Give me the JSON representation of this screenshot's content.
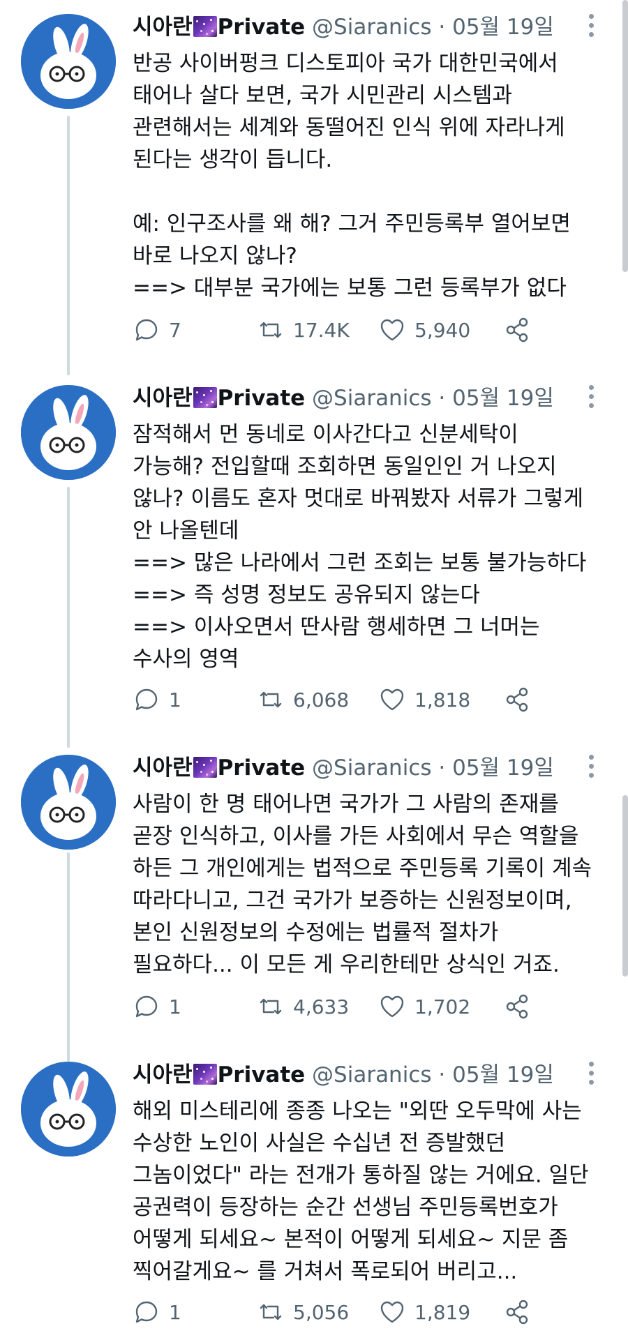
{
  "tweets": [
    {
      "name": "시아란",
      "badge": "Private",
      "handle": "@Siaranics",
      "dot": "·",
      "date": "05월 19일",
      "lines": [
        "반공 사이버펑크 디스토피아 국가 대한민국에서",
        "태어나 살다 보면, 국가 시민관리 시스템과",
        "관련해서는 세계와 동떨어진 인식 위에 자라나게",
        "된다는 생각이 듭니다.",
        "",
        "예: 인구조사를 왜 해? 그거 주민등록부 열어보면",
        "바로 나오지 않나?",
        "==> 대부분 국가에는 보통 그런 등록부가 없다"
      ],
      "replies": "7",
      "retweets": "17.4K",
      "likes": "5,940"
    },
    {
      "name": "시아란",
      "badge": "Private",
      "handle": "@Siaranics",
      "dot": "·",
      "date": "05월 19일",
      "lines": [
        "잠적해서 먼 동네로 이사간다고 신분세탁이",
        "가능해? 전입할때 조회하면 동일인인 거 나오지",
        "않나? 이름도 혼자 멋대로 바꿔봤자 서류가 그렇게",
        "안 나올텐데",
        "==> 많은 나라에서 그런 조회는 보통 불가능하다",
        "==> 즉 성명 정보도 공유되지 않는다",
        "==> 이사오면서 딴사람 행세하면 그 너머는",
        "수사의 영역"
      ],
      "replies": "1",
      "retweets": "6,068",
      "likes": "1,818"
    },
    {
      "name": "시아란",
      "badge": "Private",
      "handle": "@Siaranics",
      "dot": "·",
      "date": "05월 19일",
      "lines": [
        "사람이 한 명 태어나면 국가가 그 사람의 존재를",
        "곧장 인식하고, 이사를 가든 사회에서 무슨 역할을",
        "하든 그 개인에게는 법적으로 주민등록 기록이 계속",
        "따라다니고, 그건 국가가 보증하는 신원정보이며,",
        "본인 신원정보의 수정에는 법률적 절차가",
        "필요하다... 이 모든 게 우리한테만 상식인 거죠."
      ],
      "replies": "1",
      "retweets": "4,633",
      "likes": "1,702"
    },
    {
      "name": "시아란",
      "badge": "Private",
      "handle": "@Siaranics",
      "dot": "·",
      "date": "05월 19일",
      "lines": [
        "해외 미스테리에 종종 나오는 \"외딴 오두막에 사는",
        "수상한 노인이 사실은 수십년 전 증발했던",
        "그놈이었다\" 라는 전개가 통하질 않는 거에요. 일단",
        "공권력이 등장하는 순간 선생님 주민등록번호가",
        "어떻게 되세요~ 본적이 어떻게 되세요~ 지문 좀",
        "찍어갈게요~ 를 거쳐서 폭로되어 버리고..."
      ],
      "replies": "1",
      "retweets": "5,056",
      "likes": "1,819"
    }
  ]
}
